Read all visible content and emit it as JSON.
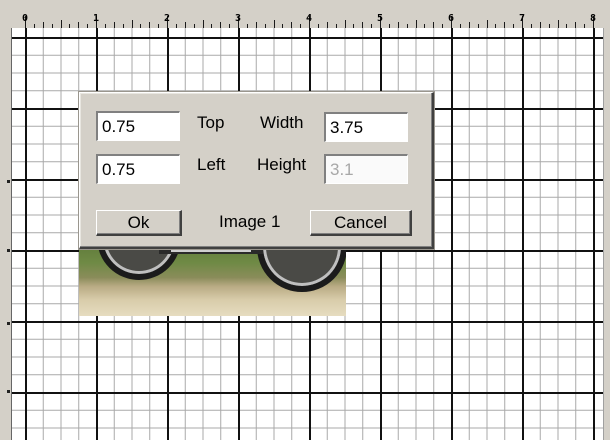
{
  "ruler": {
    "numbers": [
      "0",
      "1",
      "2",
      "3",
      "4",
      "5",
      "6",
      "7",
      "8"
    ]
  },
  "dialog": {
    "top_value": "0.75",
    "left_value": "0.75",
    "width_value": "3.75",
    "height_value": "3.1",
    "top_label": "Top",
    "left_label": "Left",
    "width_label": "Width",
    "height_label": "Height",
    "ok_label": "Ok",
    "cancel_label": "Cancel",
    "image_name": "Image 1"
  },
  "colors": {
    "face": "#d4d0c8",
    "grid_major": "#111111",
    "grid_minor": "#a8a8a8"
  }
}
